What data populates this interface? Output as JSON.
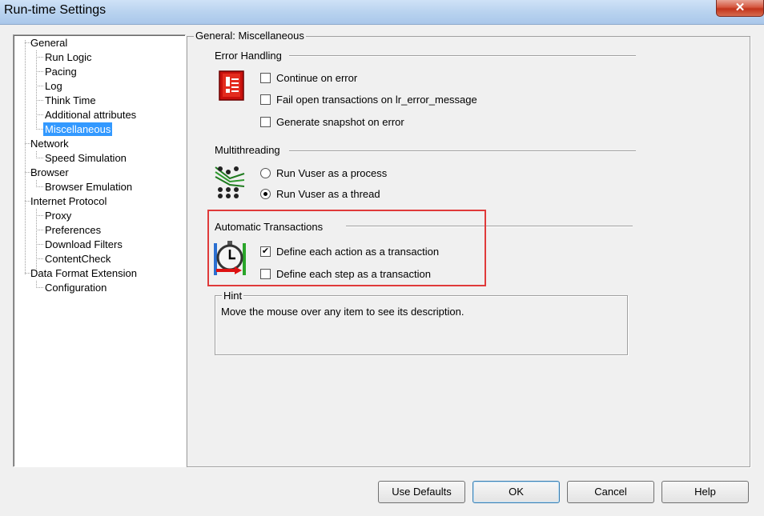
{
  "window": {
    "title": "Run-time Settings",
    "close_glyph": "✕"
  },
  "tree": {
    "items": [
      {
        "label": "General"
      },
      {
        "label": "Run Logic"
      },
      {
        "label": "Pacing"
      },
      {
        "label": "Log"
      },
      {
        "label": "Think Time"
      },
      {
        "label": "Additional attributes"
      },
      {
        "label": "Miscellaneous",
        "selected": true
      },
      {
        "label": "Network"
      },
      {
        "label": "Speed Simulation"
      },
      {
        "label": "Browser"
      },
      {
        "label": "Browser Emulation"
      },
      {
        "label": "Internet Protocol"
      },
      {
        "label": "Proxy"
      },
      {
        "label": "Preferences"
      },
      {
        "label": "Download Filters"
      },
      {
        "label": "ContentCheck"
      },
      {
        "label": "Data Format Extension"
      },
      {
        "label": "Configuration"
      }
    ]
  },
  "panel": {
    "title": "General: Miscellaneous",
    "error_handling": {
      "title": "Error Handling",
      "icon": "error-icon",
      "options": [
        {
          "label": "Continue on error",
          "checked": false
        },
        {
          "label": "Fail open transactions on lr_error_message",
          "checked": false
        },
        {
          "label": "Generate snapshot on error",
          "checked": false
        }
      ]
    },
    "multithreading": {
      "title": "Multithreading",
      "icon": "threads-icon",
      "options": [
        {
          "label": "Run Vuser as a process",
          "selected": false
        },
        {
          "label": "Run Vuser as a thread",
          "selected": true
        }
      ]
    },
    "automatic_transactions": {
      "title": "Automatic Transactions",
      "icon": "stopwatch-icon",
      "options": [
        {
          "label": "Define each action as a transaction",
          "checked": true
        },
        {
          "label": "Define each step as a transaction",
          "checked": false
        }
      ]
    },
    "hint": {
      "title": "Hint",
      "text": "Move the mouse over any item to see its description."
    }
  },
  "buttons": {
    "use_defaults": "Use Defaults",
    "ok": "OK",
    "cancel": "Cancel",
    "help": "Help"
  },
  "colors": {
    "selection": "#3399ff",
    "highlight_box": "#e03a3a"
  }
}
